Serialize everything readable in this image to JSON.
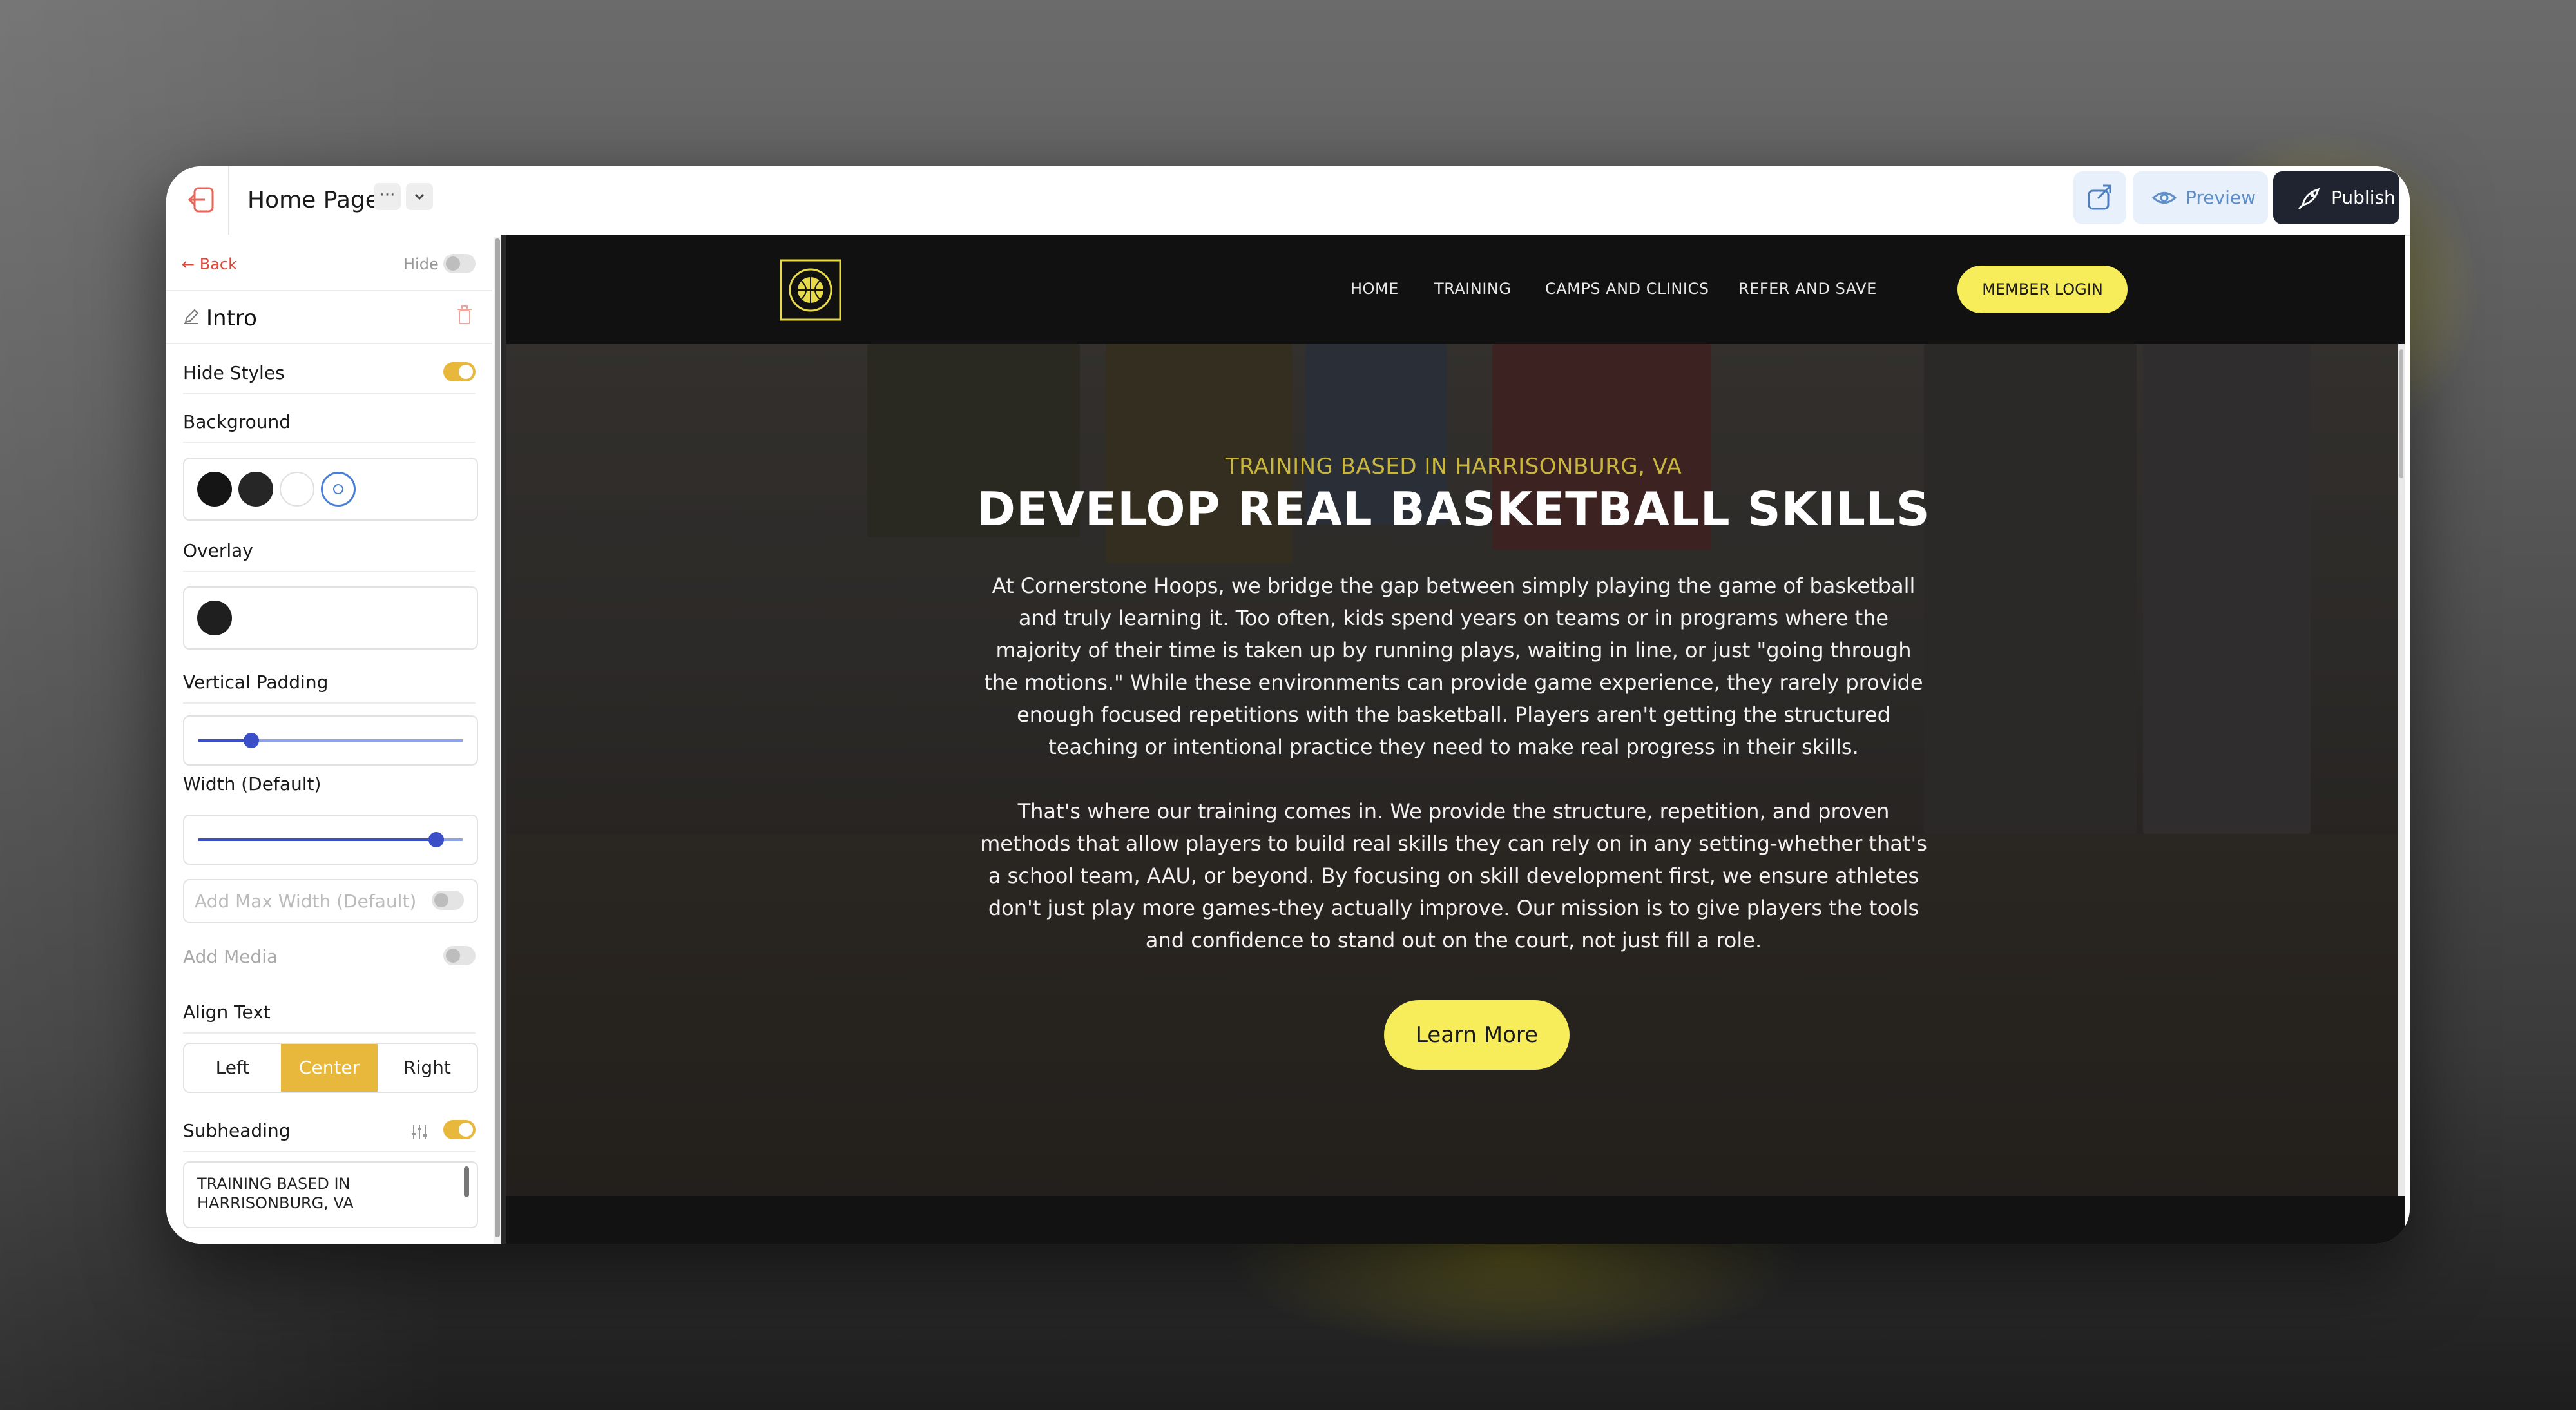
{
  "editor": {
    "page_title": "Home Page",
    "more_label": "···",
    "preview_label": "Preview",
    "publish_label": "Publish"
  },
  "sidebar": {
    "back_label": "Back",
    "hide_label": "Hide",
    "hide_on": false,
    "section_title": "Intro",
    "hide_styles_label": "Hide Styles",
    "hide_styles_on": true,
    "background_label": "Background",
    "background_swatches": [
      "#1a1a1a",
      "#2a2a2a"
    ],
    "overlay_label": "Overlay",
    "overlay_swatch": "#1f1f1f",
    "vertical_padding_label": "Vertical Padding",
    "vertical_padding_value": 0.2,
    "width_label": "Width (Default)",
    "width_value": 0.9,
    "max_width_label": "Add Max Width (Default)",
    "max_width_on": false,
    "add_media_label": "Add Media",
    "add_media_on": false,
    "align_text_label": "Align Text",
    "align_options": [
      "Left",
      "Center",
      "Right"
    ],
    "align_selected": "Center",
    "subheading_label": "Subheading",
    "subheading_on": true,
    "subheading_value": "TRAINING BASED IN HARRISONBURG, VA"
  },
  "site": {
    "nav": [
      "HOME",
      "TRAINING",
      "CAMPS AND CLINICS",
      "REFER AND SAVE"
    ],
    "member_login": "MEMBER LOGIN",
    "accent_color": "#f7ec5a",
    "hero": {
      "subheading": "TRAINING BASED IN HARRISONBURG, VA",
      "title": "DEVELOP REAL BASKETBALL SKILLS",
      "paragraph_1": "At Cornerstone Hoops, we bridge the gap between simply playing the game of basketball and truly learning it. Too often, kids spend years on teams or in programs where the majority of their time is taken up by running plays, waiting in line, or just \"going through the motions.\" While these environments can provide game experience, they rarely provide enough focused repetitions with the basketball. Players aren't getting the structured teaching or intentional practice they need to make real progress in their skills.",
      "paragraph_2": "That's where our training comes in. We provide the structure, repetition, and proven methods that allow players to build real skills they can rely on in any setting-whether that's a school team, AAU, or beyond. By focusing on skill development first, we ensure athletes don't just play more games-they actually improve. Our mission is to give players the tools and confidence to stand out on the court, not just fill a role.",
      "cta": "Learn More"
    }
  }
}
